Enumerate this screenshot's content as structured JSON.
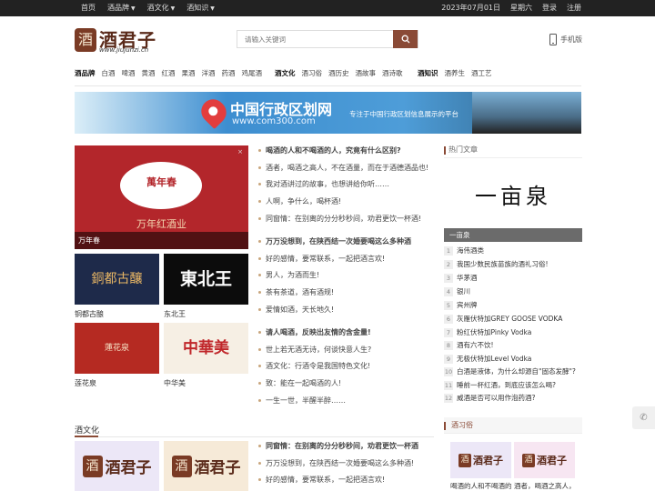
{
  "topbar": {
    "left": [
      {
        "label": "首页"
      },
      {
        "label": "酒品牌"
      },
      {
        "label": "酒文化"
      },
      {
        "label": "酒知识"
      }
    ],
    "date": "2023年07月01日",
    "weekday": "星期六",
    "login": "登录",
    "register": "注册"
  },
  "logo": {
    "seal": "酒",
    "name": "酒君子",
    "url": "www.jiujunzi.cn"
  },
  "search": {
    "placeholder": "请输入关键词"
  },
  "mobile_label": "手机版",
  "nav": {
    "brand": {
      "title": "酒品牌",
      "items": [
        "白酒",
        "啤酒",
        "黄酒",
        "红酒",
        "果酒",
        "洋酒",
        "药酒",
        "鸡尾酒"
      ]
    },
    "culture": {
      "title": "酒文化",
      "items": [
        "酒习俗",
        "酒历史",
        "酒故事",
        "酒诗歌"
      ]
    },
    "knowledge": {
      "title": "酒知识",
      "items": [
        "酒养生",
        "酒工艺"
      ]
    }
  },
  "banner": {
    "title": "中国行政区划网",
    "url": "www.com300.com",
    "slogan": "专注于中国行政区划信息展示的平台"
  },
  "feature": {
    "main": {
      "caption": "万年春",
      "art_top": "萬年春",
      "art_bottom": "万年红酒业",
      "close": "×"
    },
    "tiles": [
      {
        "caption": "铜都古酿",
        "art": "銅都古釀"
      },
      {
        "caption": "东北王",
        "art": "東北王"
      },
      {
        "caption": "莲花泉",
        "art": "蓮花泉"
      },
      {
        "caption": "中华美",
        "art": "中華美"
      }
    ]
  },
  "articles": [
    {
      "head": "喝酒的人和不喝酒的人，究竟有什么区别?",
      "rows": [
        "酒者，喝酒之高人，不在酒量，而在于酒德酒品也!",
        "我对酒讲过的故事，也想讲给你听……",
        "人啊，争什么，喝杯酒!",
        "同窗情：在别离的分分秒秒间，劝君更饮一杯酒!"
      ]
    },
    {
      "head": "万万没想到，在陕西结一次婚要喝这么多种酒",
      "rows": [
        "好的感情，要常联系，一起把酒言欢!",
        "男人，为酒而生!",
        "茶有茶道，酒有酒规!",
        "爱情如酒，天长地久!"
      ]
    },
    {
      "head": "请人喝酒，反映出友情的含金量!",
      "rows": [
        "世上若无酒无诗，何谈快意人生?",
        "酒文化：行酒令是我国特色文化!",
        "致：能在一起喝酒的人!",
        "一生一世，半醒半醉……"
      ]
    },
    {
      "head": "同窗情：在别离的分分秒秒间，劝君更饮一杯酒",
      "rows": [
        "万万没想到，在陕西结一次婚要喝这么多种酒!",
        "好的感情，要常联系，一起把酒言欢!"
      ]
    }
  ],
  "section_culture": "酒文化",
  "sidebar": {
    "hot_title": "热门文章",
    "feature_art": "一亩泉",
    "feature_caption": "一亩泉",
    "hot": [
      "海伟酒类",
      "我国少数民族苗族的酒礼习俗!",
      "华茅酒",
      "银川",
      "宾州牌",
      "灰雁伏特加GREY GOOSE VODKA",
      "粉红伏特加Pinky Vodka",
      "酒有六不饮!",
      "无极伏特加Level Vodka",
      "白酒是液体，为什么却源自\"固态发酵\"?",
      "睡前一杯红酒，到底应该怎么喝?",
      "威酒是否可以用作泡药酒?"
    ],
    "custom_title": "酒习俗",
    "custom_captions": [
      "喝酒的人和不喝酒的",
      "酒者，喝酒之高人，不"
    ]
  },
  "colors": {
    "accent": "#8a4a36",
    "topbar": "#222222"
  },
  "icons": {
    "search": "search-icon",
    "phone": "phone-icon",
    "mobile": "mobile-icon"
  }
}
